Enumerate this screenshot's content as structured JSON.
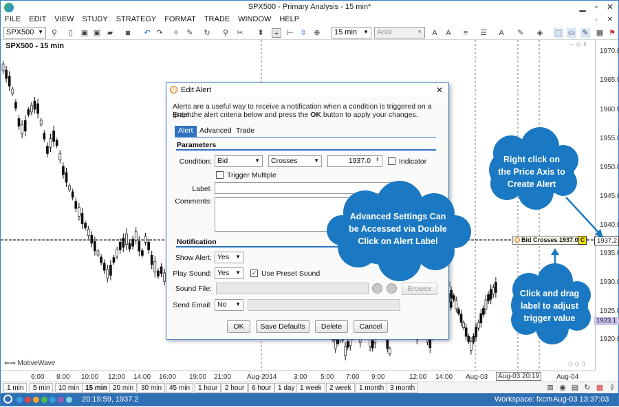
{
  "window": {
    "title": "SPX500 - Primary Analysis - 15 min*"
  },
  "menu": [
    "FILE",
    "EDIT",
    "VIEW",
    "STUDY",
    "STRATEGY",
    "FORMAT",
    "TRADE",
    "WINDOW",
    "HELP"
  ],
  "toolbar": {
    "symbol": "SPX500",
    "timeframe": "15 min",
    "font": "Arial"
  },
  "chart": {
    "title": "SPX500 - 15 min",
    "watermark": "MotiveWave",
    "price_labels": [
      "1970.0",
      "1965.0",
      "1960.0",
      "1955.0",
      "1950.0",
      "1945.0",
      "1940.0",
      "1935.0",
      "1930.0",
      "1925.0",
      "1920.0"
    ],
    "time_labels": [
      "6:00",
      "8:00",
      "10:00",
      "12:00",
      "14:00",
      "16:00",
      "19:00",
      "21:00",
      "Aug-2014",
      "3:00",
      "5:00",
      "7:00",
      "9:00",
      "12:00",
      "14:00",
      "Aug-03",
      "Aug-03 20:19",
      "Aug-04"
    ],
    "alert_label": "Bid Crosses 1937.0",
    "alert_badge": "C",
    "alert_price_tag": "1937.2",
    "bid_price_tag": "1923.1"
  },
  "timeframes": [
    "1 min",
    "5 min",
    "10 min",
    "15 min",
    "20 min",
    "30 min",
    "45 min",
    "1 hour",
    "2 hour",
    "6 hour",
    "1 day",
    "1 week",
    "2 week",
    "1 month",
    "3 month"
  ],
  "active_timeframe": "15 min",
  "status": {
    "crosshair": "20:19:59, 1937.2",
    "workspace": "Workspace: fxcm",
    "datetime": "Aug-03 13:37:03"
  },
  "dialog": {
    "title": "Edit Alert",
    "intro_line1": "Alerts are a useful way to receive a notification when a condition is triggered on a graph.",
    "intro_line2_a": "Enter the alert criteria below and press the ",
    "intro_line2_b": "OK",
    "intro_line2_c": " button to apply your changes.",
    "tabs": [
      "Alert",
      "Advanced",
      "Trade"
    ],
    "parameters_heading": "Parameters",
    "condition_label": "Condition:",
    "condition_source": "Bid",
    "condition_op": "Crosses",
    "condition_value": "1937.0",
    "indicator_label": "Indicator",
    "trigger_multiple_label": "Trigger Multiple",
    "label_label": "Label:",
    "label_value": "",
    "comments_label": "Comments:",
    "notification_heading": "Notification",
    "show_alert_label": "Show Alert:",
    "show_alert_value": "Yes",
    "play_sound_label": "Play Sound:",
    "play_sound_value": "Yes",
    "use_preset_sound_label": "Use Preset Sound",
    "sound_file_label": "Sound File:",
    "browse_label": "Browse",
    "send_email_label": "Send Email:",
    "send_email_value": "No",
    "ok_label": "OK",
    "save_defaults_label": "Save Defaults",
    "delete_label": "Delete",
    "cancel_label": "Cancel"
  },
  "callouts": {
    "advanced": "Advanced Settings Can be Accessed via Double Click on Alert Label",
    "right_click": "Right click on the Price Axis to Create Alert",
    "drag": "Click and drag label to adjust trigger value"
  },
  "colors": {
    "accent": "#2f73c0",
    "callout": "#1878c0",
    "status_bar": "#2f6fb4",
    "alert_line": "#222222"
  }
}
